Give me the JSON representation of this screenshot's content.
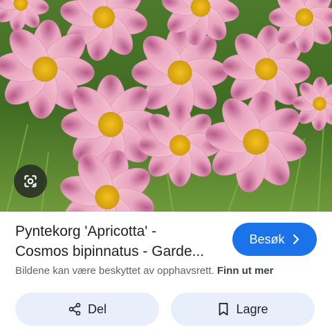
{
  "image": {
    "alt": ""
  },
  "result": {
    "title_line1": "Pyntekorg 'Apricotta' -",
    "title_line2": "Cosmos bipinnatus - Garde..."
  },
  "visit_button": {
    "label": "Besøk"
  },
  "copyright": {
    "notice": "Bildene kan være beskyttet av opphavsrett.",
    "learn_more": "Finn ut mer"
  },
  "actions": {
    "share_label": "Del",
    "save_label": "Lagre"
  },
  "colors": {
    "accent": "#1a73e8",
    "action_bg": "#e8effa",
    "text": "#202124",
    "muted": "#5f6368"
  },
  "icons": {
    "lens": "lens-icon",
    "visit": "chevron-right-icon",
    "share": "share-icon",
    "save": "bookmark-icon"
  }
}
